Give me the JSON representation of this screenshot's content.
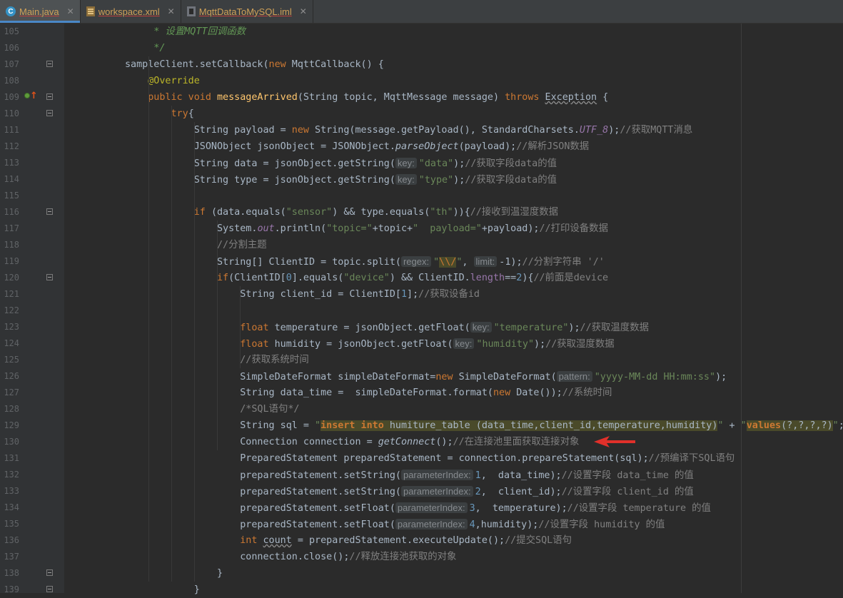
{
  "tabs": [
    {
      "label": "Main.java",
      "kind": "java",
      "icon": "java-class-icon",
      "active": true
    },
    {
      "label": "workspace.xml",
      "kind": "xml",
      "icon": "xml-file-icon",
      "active": false
    },
    {
      "label": "MqttDataToMySQL.iml",
      "kind": "iml",
      "icon": "iml-file-icon",
      "active": false
    }
  ],
  "colors": {
    "background": "#2b2b2b",
    "keyword": "#cc7832",
    "string": "#6a8759",
    "comment": "#808080",
    "annotation": "#bbb529",
    "arrow": "#e0302a"
  },
  "gutter_icons": {
    "line_109": [
      "implements-method-icon",
      "override-up-arrow-icon"
    ]
  },
  "lines": [
    {
      "n": "105",
      "t": [
        [
          "     * 设置",
          "doc"
        ],
        [
          "MQTT",
          "doc"
        ],
        [
          "回调函数",
          "doc"
        ]
      ]
    },
    {
      "n": "106",
      "t": [
        [
          "     */",
          "doc"
        ]
      ]
    },
    {
      "n": "107",
      "fold": true,
      "t": [
        [
          "sampleClient.setCallback(",
          ""
        ],
        [
          "new ",
          "kw"
        ],
        [
          "MqttCallback() {",
          ""
        ]
      ]
    },
    {
      "n": "108",
      "t": [
        [
          "    ",
          ""
        ],
        [
          "@Override",
          "ann"
        ]
      ]
    },
    {
      "n": "109",
      "fold": true,
      "t": [
        [
          "    ",
          ""
        ],
        [
          "public void ",
          "kw"
        ],
        [
          "messageArrived",
          "fn"
        ],
        [
          "(String topic, MqttMessage message) ",
          ""
        ],
        [
          "throws ",
          "kw"
        ],
        [
          "Exception",
          "wave"
        ],
        [
          " {",
          ""
        ]
      ]
    },
    {
      "n": "110",
      "fold": true,
      "t": [
        [
          "        ",
          ""
        ],
        [
          "try",
          "kw"
        ],
        [
          "{",
          ""
        ]
      ]
    },
    {
      "n": "111",
      "t": [
        [
          "            String payload = ",
          ""
        ],
        [
          "new ",
          "kw"
        ],
        [
          "String(message.getPayload(), StandardCharsets.",
          ""
        ],
        [
          "UTF_8",
          "sfld"
        ],
        [
          ");",
          ""
        ],
        [
          "//获取MQTT消息",
          "cmt"
        ]
      ]
    },
    {
      "n": "112",
      "t": [
        [
          "            JSONObject jsonObject = JSONObject.",
          ""
        ],
        [
          "parseObject",
          "ital"
        ],
        [
          "(payload);",
          ""
        ],
        [
          "//解析JSON数据",
          "cmt"
        ]
      ]
    },
    {
      "n": "113",
      "t": [
        [
          "            String data = jsonObject.getString(",
          ""
        ],
        [
          "key:",
          "hint"
        ],
        [
          "\"data\"",
          "str"
        ],
        [
          ");",
          ""
        ],
        [
          "//获取字段data的值",
          "cmt"
        ]
      ]
    },
    {
      "n": "114",
      "t": [
        [
          "            String type = jsonObject.getString(",
          ""
        ],
        [
          "key:",
          "hint"
        ],
        [
          "\"type\"",
          "str"
        ],
        [
          ");",
          ""
        ],
        [
          "//获取字段data的值",
          "cmt"
        ]
      ]
    },
    {
      "n": "115",
      "t": []
    },
    {
      "n": "116",
      "fold": true,
      "t": [
        [
          "            ",
          ""
        ],
        [
          "if ",
          "kw"
        ],
        [
          "(data.equals(",
          ""
        ],
        [
          "\"sensor\"",
          "str"
        ],
        [
          ") && type.equals(",
          ""
        ],
        [
          "\"th\"",
          "str"
        ],
        [
          ")){",
          ""
        ],
        [
          "//接收到温湿度数据",
          "cmt"
        ]
      ]
    },
    {
      "n": "117",
      "t": [
        [
          "                System.",
          ""
        ],
        [
          "out",
          "sfld"
        ],
        [
          ".println(",
          ""
        ],
        [
          "\"topic=\"",
          "str"
        ],
        [
          "+topic+",
          ""
        ],
        [
          "\"  payload=\"",
          "str"
        ],
        [
          "+payload);",
          ""
        ],
        [
          "//打印设备数据",
          "cmt"
        ]
      ]
    },
    {
      "n": "118",
      "t": [
        [
          "                ",
          ""
        ],
        [
          "//分割主题",
          "cmt"
        ]
      ]
    },
    {
      "n": "119",
      "t": [
        [
          "                String[] ClientID = topic.split(",
          ""
        ],
        [
          "regex:",
          "hint"
        ],
        [
          "\"",
          "str"
        ],
        [
          "\\\\/",
          "esc"
        ],
        [
          "\"",
          "str"
        ],
        [
          ", ",
          ""
        ],
        [
          "limit:",
          "hint"
        ],
        [
          "-1",
          ""
        ],
        [
          ");",
          ""
        ],
        [
          "//分割字符串 '/'",
          "cmt"
        ]
      ]
    },
    {
      "n": "120",
      "fold": true,
      "t": [
        [
          "                ",
          ""
        ],
        [
          "if",
          "kw"
        ],
        [
          "(ClientID[",
          ""
        ],
        [
          "0",
          "num"
        ],
        [
          "].equals(",
          ""
        ],
        [
          "\"device\"",
          "str"
        ],
        [
          ") && ClientID.",
          ""
        ],
        [
          "length",
          "fld"
        ],
        [
          "==",
          ""
        ],
        [
          "2",
          "num"
        ],
        [
          "){",
          ""
        ],
        [
          "//前面是device",
          "cmt"
        ]
      ]
    },
    {
      "n": "121",
      "t": [
        [
          "                    String client_id = ClientID[",
          ""
        ],
        [
          "1",
          "num"
        ],
        [
          "];",
          ""
        ],
        [
          "//获取设备id",
          "cmt"
        ]
      ]
    },
    {
      "n": "122",
      "t": []
    },
    {
      "n": "123",
      "t": [
        [
          "                    ",
          ""
        ],
        [
          "float ",
          "kw"
        ],
        [
          "temperature = jsonObject.getFloat(",
          ""
        ],
        [
          "key:",
          "hint"
        ],
        [
          "\"temperature\"",
          "str"
        ],
        [
          ");",
          ""
        ],
        [
          "//获取温度数据",
          "cmt"
        ]
      ]
    },
    {
      "n": "124",
      "t": [
        [
          "                    ",
          ""
        ],
        [
          "float ",
          "kw"
        ],
        [
          "humidity = jsonObject.getFloat(",
          ""
        ],
        [
          "key:",
          "hint"
        ],
        [
          "\"humidity\"",
          "str"
        ],
        [
          ");",
          ""
        ],
        [
          "//获取湿度数据",
          "cmt"
        ]
      ]
    },
    {
      "n": "125",
      "t": [
        [
          "                    ",
          ""
        ],
        [
          "//获取系统时间",
          "cmt"
        ]
      ]
    },
    {
      "n": "126",
      "t": [
        [
          "                    SimpleDateFormat simpleDateFormat=",
          ""
        ],
        [
          "new ",
          "kw"
        ],
        [
          "SimpleDateFormat(",
          ""
        ],
        [
          "pattern:",
          "hint"
        ],
        [
          "\"yyyy-MM-dd HH:mm:ss\"",
          "str"
        ],
        [
          ");",
          ""
        ]
      ]
    },
    {
      "n": "127",
      "t": [
        [
          "                    String data_time =  simpleDateFormat.format(",
          ""
        ],
        [
          "new ",
          "kw"
        ],
        [
          "Date());",
          ""
        ],
        [
          "//系统时间",
          "cmt"
        ]
      ]
    },
    {
      "n": "128",
      "t": [
        [
          "                    ",
          ""
        ],
        [
          "/*SQL语句*/",
          "cmt"
        ]
      ]
    },
    {
      "n": "129",
      "t": [
        [
          "                    String sql = ",
          ""
        ],
        [
          "\"",
          "str"
        ],
        [
          "insert into",
          "sqlkw"
        ],
        [
          " humiture_table (data_time,client_id,temperature,humidity)",
          "sql"
        ],
        [
          "\"",
          "str"
        ],
        [
          " + ",
          ""
        ],
        [
          "\"",
          "str"
        ],
        [
          "values",
          "sqlkw"
        ],
        [
          "(?,?,?,?)",
          "sql"
        ],
        [
          "\"",
          "str"
        ],
        [
          ";",
          ""
        ]
      ]
    },
    {
      "n": "130",
      "t": [
        [
          "                    Connection connection = ",
          ""
        ],
        [
          "getConnect",
          "ital"
        ],
        [
          "();",
          ""
        ],
        [
          "//在连接池里面获取连接对象",
          "cmt"
        ]
      ]
    },
    {
      "n": "131",
      "t": [
        [
          "                    PreparedStatement preparedStatement = connection.prepareStatement(sql);",
          ""
        ],
        [
          "//预编译下SQL语句",
          "cmt"
        ]
      ]
    },
    {
      "n": "132",
      "t": [
        [
          "                    preparedStatement.setString(",
          ""
        ],
        [
          "parameterIndex:",
          "hint"
        ],
        [
          "1",
          "num"
        ],
        [
          ",  data_time);",
          ""
        ],
        [
          "//设置字段 data_time 的值",
          "cmt"
        ]
      ]
    },
    {
      "n": "133",
      "t": [
        [
          "                    preparedStatement.setString(",
          ""
        ],
        [
          "parameterIndex:",
          "hint"
        ],
        [
          "2",
          "num"
        ],
        [
          ",  client_id);",
          ""
        ],
        [
          "//设置字段 client_id 的值",
          "cmt"
        ]
      ]
    },
    {
      "n": "134",
      "t": [
        [
          "                    preparedStatement.setFloat(",
          ""
        ],
        [
          "parameterIndex:",
          "hint"
        ],
        [
          "3",
          "num"
        ],
        [
          ",  temperature);",
          ""
        ],
        [
          "//设置字段 temperature 的值",
          "cmt"
        ]
      ]
    },
    {
      "n": "135",
      "t": [
        [
          "                    preparedStatement.setFloat(",
          ""
        ],
        [
          "parameterIndex:",
          "hint"
        ],
        [
          "4",
          "num"
        ],
        [
          ",humidity);",
          ""
        ],
        [
          "//设置字段 humidity 的值",
          "cmt"
        ]
      ]
    },
    {
      "n": "136",
      "t": [
        [
          "                    ",
          ""
        ],
        [
          "int ",
          "kw"
        ],
        [
          "count",
          "wave"
        ],
        [
          " = preparedStatement.executeUpdate();",
          ""
        ],
        [
          "//提交SQL语句",
          "cmt"
        ]
      ]
    },
    {
      "n": "137",
      "t": [
        [
          "                    connection.close();",
          ""
        ],
        [
          "//释放连接池获取的对象",
          "cmt"
        ]
      ]
    },
    {
      "n": "138",
      "fold": true,
      "t": [
        [
          "                }",
          ""
        ]
      ]
    },
    {
      "n": "139",
      "fold": true,
      "t": [
        [
          "            }",
          ""
        ]
      ]
    }
  ]
}
